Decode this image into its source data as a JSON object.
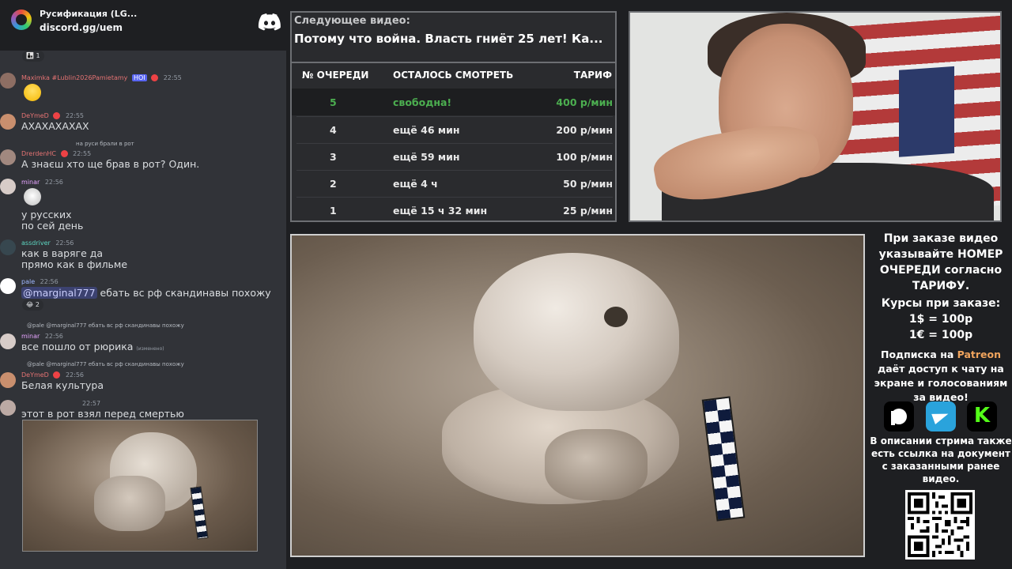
{
  "chat": {
    "server_name": "Русификация (LG...",
    "server_link": "discord.gg/uem",
    "reaction_top": {
      "emoji": "👨‍👦",
      "count": "1"
    },
    "messages": [
      {
        "user": "Maximka #Lublin2026Pamietamy",
        "user_color": "#e57373",
        "tag": "HOI",
        "time": "22:55",
        "text": ""
      },
      {
        "user": "DeYmeD",
        "user_color": "#e57373",
        "time": "22:55",
        "text": "АХАХАХАХАХ"
      },
      {
        "reply": "на руси брали в рот",
        "user": "DrerdenHC",
        "user_color": "#e57373",
        "time": "22:55",
        "text": "А знаєш хто ще брав в рот? Один."
      },
      {
        "user": "minar",
        "user_color": "#e6a4ff",
        "time": "22:56",
        "text1": "у русских",
        "text2": "по сей день"
      },
      {
        "user": "assdriver",
        "user_color": "#5dd6c1",
        "time": "22:56",
        "text1": "как в варяге да",
        "text2": "прямо как в фильме"
      },
      {
        "user": "pale",
        "user_color": "#9fb8ff",
        "time": "22:56",
        "mention": "@marginal777",
        "text": " ебать вс рф скандинавы похожу",
        "reaction_count": "2"
      },
      {
        "reply": "@pale @marginal777 ебать вс рф скандинавы похожу",
        "user": "minar",
        "user_color": "#e6a4ff",
        "time": "22:56",
        "text": "все пошло от рюрика",
        "edited": "(изменено)"
      },
      {
        "reply": "@pale @marginal777 ебать вс рф скандинавы похожу",
        "user": "DeYmeD",
        "user_color": "#e57373",
        "time": "22:56",
        "text": "Белая культура"
      },
      {
        "time": "22:57",
        "text": "этот в рот взял перед смертью"
      }
    ]
  },
  "queue": {
    "next_label": "Следующее видео:",
    "next_title": "Потому что война. Власть гниёт 25 лет! Ка...",
    "headers": {
      "num": "№ ОЧЕРЕДИ",
      "left": "ОСТАЛОСЬ СМОТРЕТЬ",
      "tariff": "ТАРИФ"
    },
    "rows": [
      {
        "num": "5",
        "left": "свободна!",
        "tariff": "400 р/мин"
      },
      {
        "num": "4",
        "left": "ещё 46 мин",
        "tariff": "200 р/мин"
      },
      {
        "num": "3",
        "left": "ещё 59 мин",
        "tariff": "100 р/мин"
      },
      {
        "num": "2",
        "left": "ещё 4 ч",
        "tariff": "50 р/мин"
      },
      {
        "num": "1",
        "left": "ещё 15 ч 32 мин",
        "tariff": "25 р/мин"
      }
    ]
  },
  "info": {
    "main": "При заказе видео указывайте НОМЕР ОЧЕРЕДИ согласно ТАРИФУ.",
    "rates_title": "Курсы при заказе:",
    "rate_usd": "1$ = 100р",
    "rate_eur": "1€ = 100р",
    "sub_prefix": "Подписка на ",
    "sub_patreon": "Patreon",
    "sub_suffix": " даёт доступ к чату на экране и голосованиям за видео!",
    "desc": "В описании стрима также есть ссылка на документ с заказанными ранее видео."
  },
  "colors": {
    "accent_green": "#4caf50",
    "patreon": "#f0a45d",
    "telegram": "#2aa3dc",
    "kick": "#53fc18"
  },
  "icons": [
    "discord-icon",
    "patreon-icon",
    "telegram-icon",
    "kick-icon",
    "qr-code"
  ]
}
